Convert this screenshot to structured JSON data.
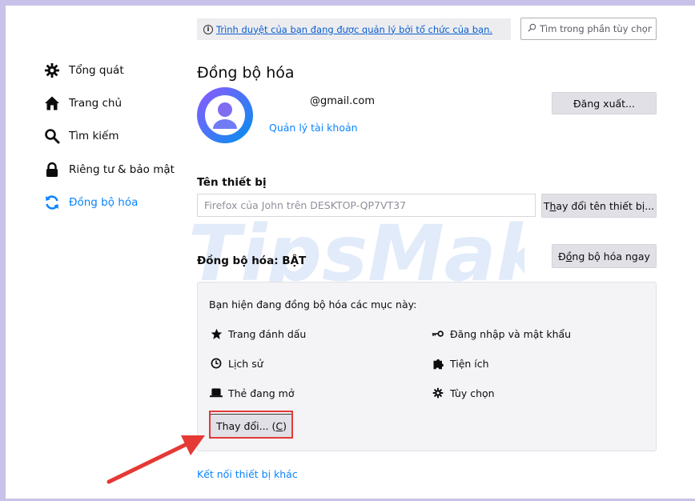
{
  "sidebar": {
    "items": [
      {
        "label": "Tổng quát",
        "icon": "gear-icon",
        "active": false
      },
      {
        "label": "Trang chủ",
        "icon": "home-icon",
        "active": false
      },
      {
        "label": "Tìm kiếm",
        "icon": "search-icon",
        "active": false
      },
      {
        "label": "Riêng tư & bảo mật",
        "icon": "lock-icon",
        "active": false
      },
      {
        "label": "Đồng bộ hóa",
        "icon": "sync-icon",
        "active": true
      }
    ]
  },
  "header": {
    "managed_notice": "Trình duyệt của bạn đang được quản lý bởi tổ chức của bạn.",
    "search_placeholder": "Tìm trong phần tùy chọn"
  },
  "account": {
    "section_title": "Đồng bộ hóa",
    "email": "@gmail.com",
    "manage_link": "Quản lý tài khoản",
    "sign_out_label": "Đăng xuất..."
  },
  "device": {
    "label": "Tên thiết bị",
    "name_value": "Firefox của John trên DESKTOP-QP7VT37",
    "rename_label_pre": "T",
    "rename_label_key": "h",
    "rename_label_post": "ay đổi tên thiết bị..."
  },
  "sync": {
    "status_label": "Đồng bộ hóa: BẬT",
    "sync_now_label_pre": "Đ",
    "sync_now_label_key": "ồ",
    "sync_now_label_post": "ng bộ hóa ngay",
    "intro": "Bạn hiện đang đồng bộ hóa các mục này:",
    "items_left": [
      {
        "label": "Trang đánh dấu",
        "icon": "star-icon"
      },
      {
        "label": "Lịch sử",
        "icon": "clock-icon"
      },
      {
        "label": "Thẻ đang mở",
        "icon": "tab-icon"
      }
    ],
    "items_right": [
      {
        "label": "Đăng nhập và mật khẩu",
        "icon": "key-icon"
      },
      {
        "label": "Tiện ích",
        "icon": "puzzle-icon"
      },
      {
        "label": "Tùy chọn",
        "icon": "gear-icon"
      }
    ],
    "change_label_pre": "Thay đổi... (",
    "change_label_key": "C",
    "change_label_post": ")",
    "connect_link": "Kết nối thiết bị khác"
  },
  "watermark": "TipsMake",
  "colors": {
    "accent": "#0a84ff",
    "highlight": "#e53935",
    "avatar_start": "#9059ff",
    "avatar_end": "#0090ed"
  }
}
